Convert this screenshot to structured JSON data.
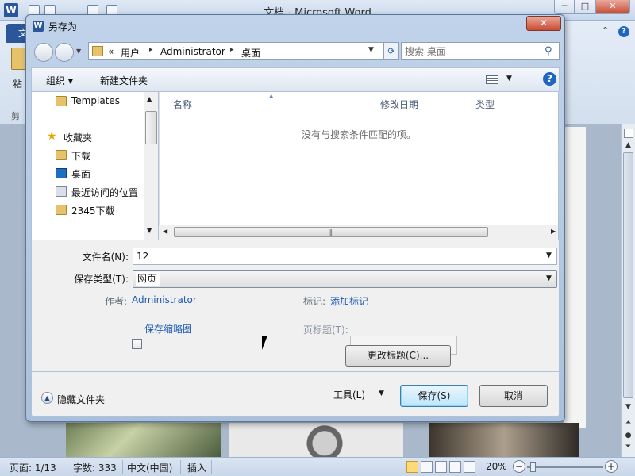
{
  "word": {
    "app_icon": "W",
    "title": "文档 - Microsoft Word",
    "window_controls": {
      "minimize": "─",
      "maximize": "□",
      "close": "✕"
    },
    "file_tab": "文",
    "paste_label": "粘",
    "clipboard_label": "剪",
    "help_icon": "?",
    "collapse_icon": "^",
    "vscroll_icon": "ruler-icon",
    "statusbar": {
      "page": "页面: 1/13",
      "words": "字数: 333",
      "language": "中文(中国)",
      "mode": "插入",
      "zoom": "20%",
      "zoom_out": "−",
      "zoom_in": "+"
    }
  },
  "dialog": {
    "icon": "W",
    "title": "另存为",
    "close": "✕",
    "breadcrumbs": [
      "«",
      "用户",
      "Administrator",
      "桌面"
    ],
    "crumb_separator": "▸",
    "search_placeholder": "搜索 桌面",
    "toolbar": {
      "organize": "组织 ▾",
      "new_folder": "新建文件夹",
      "help": "?"
    },
    "nav_items": [
      {
        "label": "Templates",
        "icon": "folder-icon"
      },
      {
        "label": "收藏夹",
        "icon": "star-icon"
      },
      {
        "label": "下载",
        "icon": "folder-icon"
      },
      {
        "label": "桌面",
        "icon": "desktop-icon"
      },
      {
        "label": "最近访问的位置",
        "icon": "recent-places-icon"
      },
      {
        "label": "2345下载",
        "icon": "folder-icon"
      }
    ],
    "columns": {
      "name": "名称",
      "modified": "修改日期",
      "type": "类型"
    },
    "empty_message": "没有与搜索条件匹配的项。",
    "form": {
      "filename_label": "文件名(N):",
      "filename_value": "12",
      "savetype_label": "保存类型(T):",
      "savetype_value": "网页",
      "author_label": "作者:",
      "author_value": "Administrator",
      "tags_label": "标记:",
      "tags_value": "添加标记",
      "thumbnail_label": "保存缩略图",
      "page_title_label": "页标题(T):",
      "change_title_button": "更改标题(C)..."
    },
    "footer": {
      "hide_folders": "隐藏文件夹",
      "tools": "工具(L)",
      "save": "保存(S)",
      "cancel": "取消"
    }
  }
}
